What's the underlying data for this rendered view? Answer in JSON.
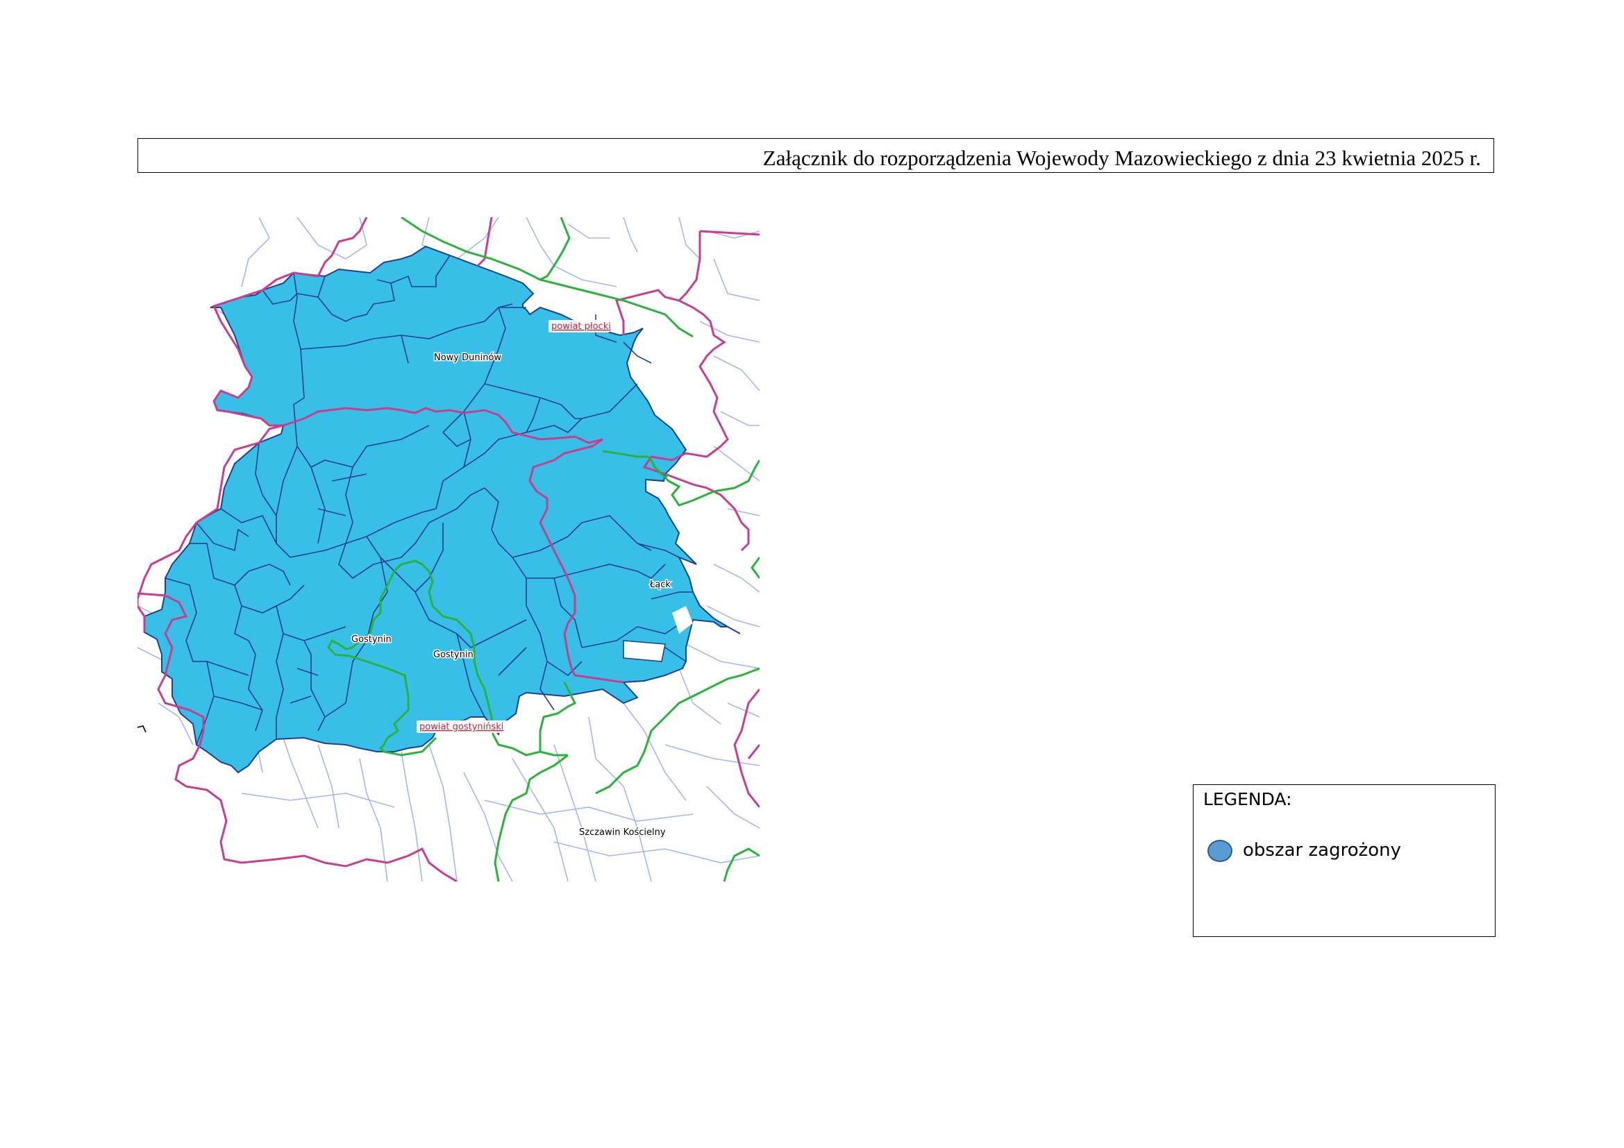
{
  "header": {
    "title": "Załącznik do rozporządzenia Wojewody Mazowieckiego z dnia 23 kwietnia 2025 r."
  },
  "map": {
    "colors": {
      "threatened_area": "#38bfe8",
      "parcel_border": "#1f3f8f",
      "county_border": "#c83e8c",
      "commune_border": "#2bb23a",
      "background_parcels": "#a8b6f0"
    },
    "labels": {
      "powiat_plocki": "powiat płocki",
      "nowy_duninow": "Nowy Duninów",
      "lack": "Łąck",
      "gostynin_commune": "Gostynin",
      "gostynin_town": "Gostynin",
      "powiat_gostyninski": "powiat gostyniński",
      "szczawin_koscielny": "Szczawin Kościelny"
    }
  },
  "legend": {
    "title": "LEGENDA:",
    "items": [
      {
        "label": "obszar zagrożony",
        "color": "#5b9bd5",
        "icon": "circle-swatch"
      }
    ]
  }
}
